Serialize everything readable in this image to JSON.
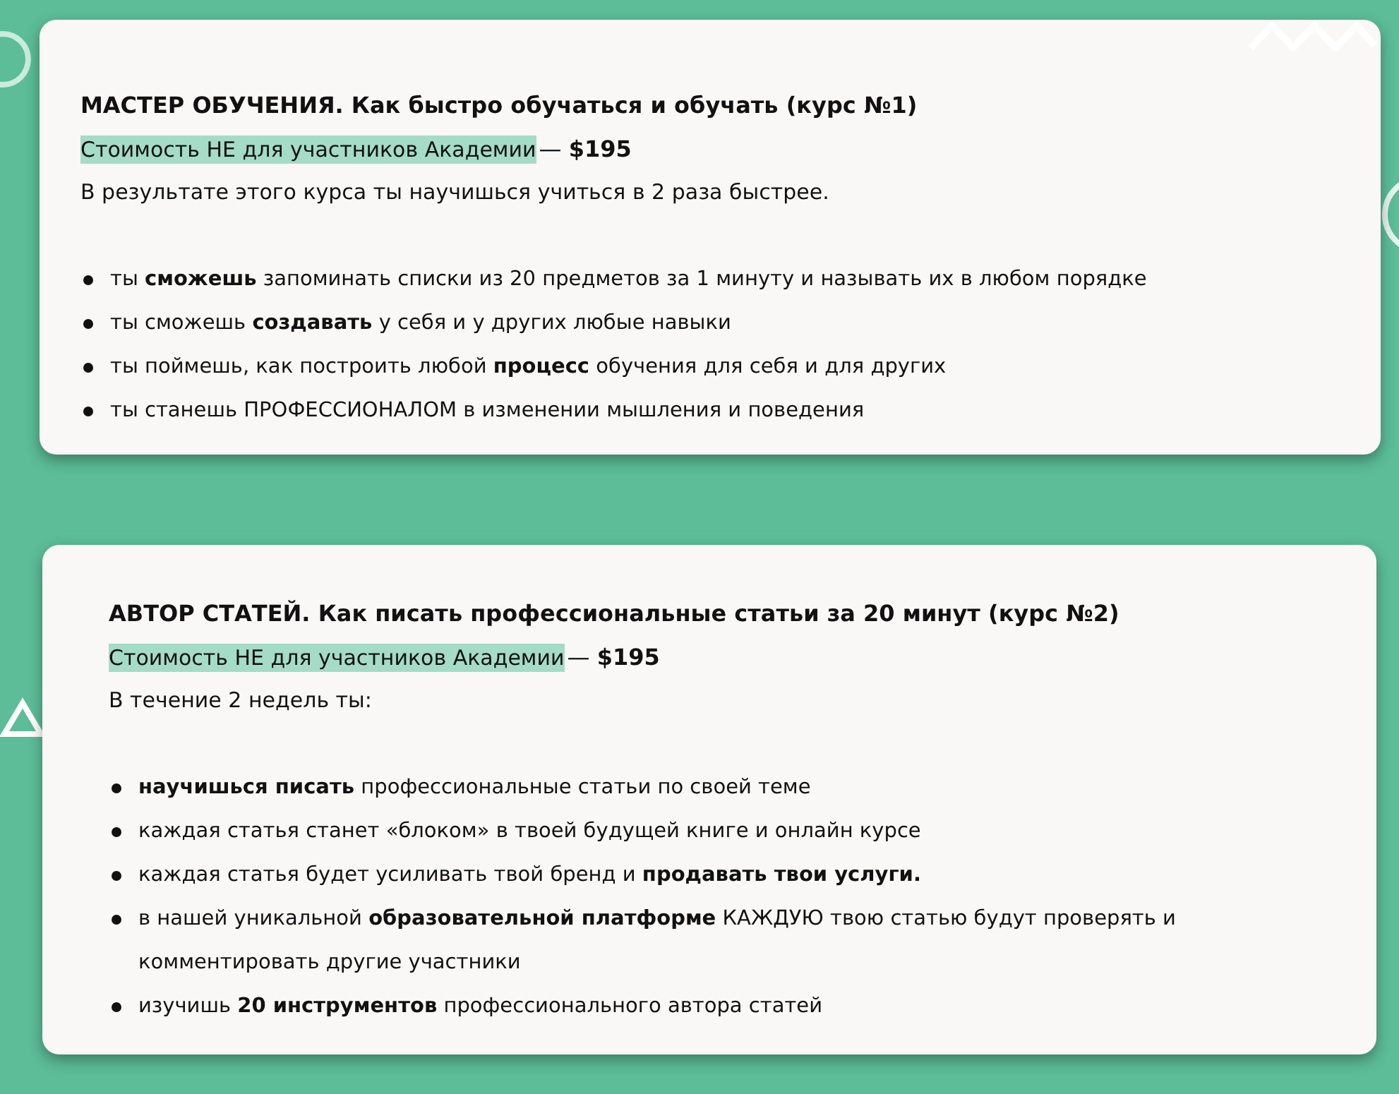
{
  "courses": [
    {
      "title": "МАСТЕР ОБУЧЕНИЯ. Как быстро обучаться и обучать (курс №1)",
      "price_label": "Стоимость НЕ для участников Академии",
      "price": "— **$195**",
      "intro": "В результате этого курса ты научишься учиться в 2 раза быстрее.",
      "bullets": [
        "ты **сможешь** запоминать списки из 20 предметов за 1 минуту и называть их в любом порядке",
        "ты сможешь **создавать** у себя и у других любые навыки",
        "ты поймешь, как построить любой **процесс** обучения для себя и для других",
        "ты станешь ПРОФЕССИОНАЛОМ в изменении мышления и поведения"
      ]
    },
    {
      "title": "АВТОР СТАТЕЙ. Как писать профессиональные статьи за 20 минут (курс №2)",
      "price_label": "Стоимость НЕ для участников Академии",
      "price": "— **$195**",
      "intro": "В течение 2 недель ты:",
      "bullets": [
        "**научишься писать** профессиональные статьи по своей теме",
        "каждая статья станет «блоком» в твоей будущей книге и онлайн курсе",
        "каждая статья будет усиливать твой бренд и **продавать твои услуги.**",
        "в нашей уникальной **образовательной платформе** КАЖДУЮ твою статью будут проверять и комментировать другие участники",
        "изучишь **20 инструментов** профессионального автора статей"
      ]
    }
  ]
}
